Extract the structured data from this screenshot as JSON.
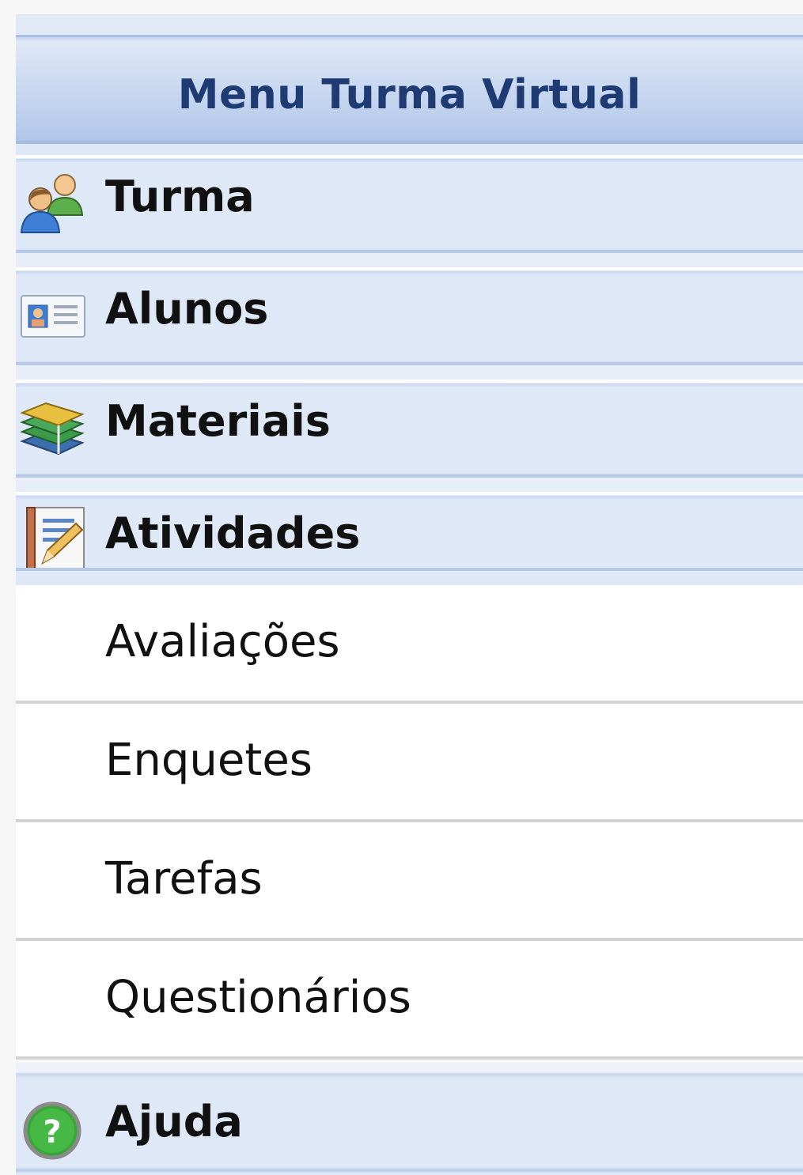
{
  "menu": {
    "title": "Menu Turma Virtual",
    "sections": [
      {
        "label": "Turma",
        "icon": "users-icon"
      },
      {
        "label": "Alunos",
        "icon": "id-card-icon"
      },
      {
        "label": "Materiais",
        "icon": "books-icon"
      },
      {
        "label": "Atividades",
        "icon": "notebook-pencil-icon"
      }
    ],
    "atividades_items": [
      {
        "label": "Avaliações"
      },
      {
        "label": "Enquetes"
      },
      {
        "label": "Tarefas"
      },
      {
        "label": "Questionários"
      }
    ],
    "help": {
      "label": "Ajuda",
      "icon": "help-icon"
    }
  },
  "colors": {
    "title_text": "#1e3c73",
    "section_bg": "#dfe8f6",
    "item_bg": "#ffffff",
    "text": "#111111"
  }
}
